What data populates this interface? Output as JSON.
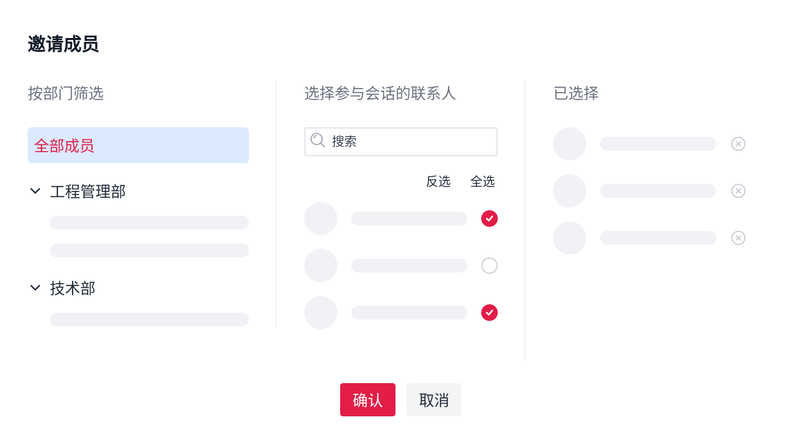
{
  "dialog": {
    "title": "邀请成员"
  },
  "left": {
    "title": "按部门筛选",
    "all_members": "全部成员",
    "groups": [
      {
        "label": "工程管理部",
        "expanded": true
      },
      {
        "label": "技术部",
        "expanded": true
      }
    ]
  },
  "middle": {
    "title": "选择参与会话的联系人",
    "search": {
      "placeholder": "搜索",
      "value": ""
    },
    "invert_label": "反选",
    "select_all_label": "全选",
    "contacts": [
      {
        "checked": true
      },
      {
        "checked": false
      },
      {
        "checked": true
      }
    ]
  },
  "right": {
    "title": "已选择",
    "selected_count": 3
  },
  "footer": {
    "confirm_label": "确认",
    "cancel_label": "取消"
  },
  "colors": {
    "accent": "#e11d48",
    "highlight": "#dbeafe",
    "placeholder": "#f0f2f5",
    "divider": "#e5e7eb"
  },
  "icons": {
    "chevron": "chevron-down-icon",
    "search": "search-icon",
    "check": "check-icon",
    "remove": "close-circle-icon"
  }
}
